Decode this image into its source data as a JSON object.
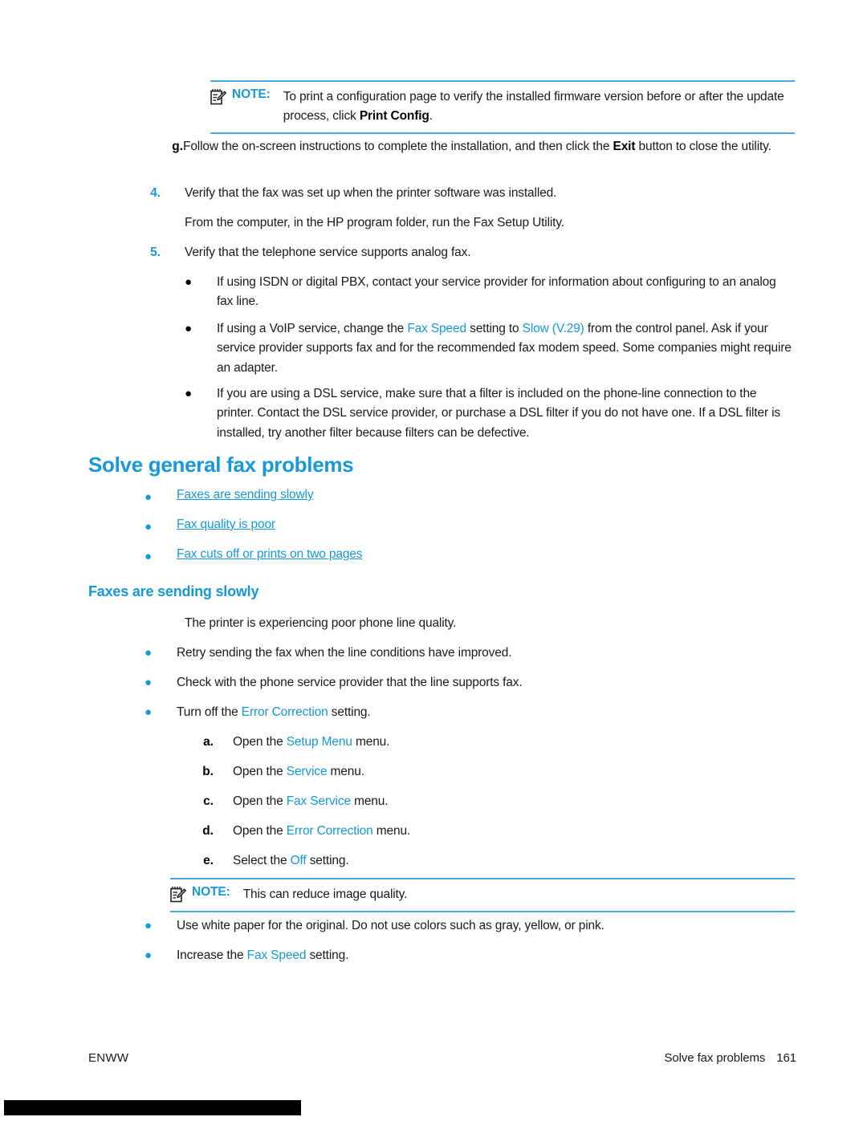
{
  "document": {
    "product": "HP printer user guide",
    "accent_color": "#1699d6",
    "note_rule_color": "#47a8e5"
  },
  "note_top": {
    "icon": "note-pad-pencil-icon",
    "label": "NOTE:",
    "text_parts": [
      {
        "text": "To print a configuration page to verify the installed firmware version before or after the update process, click ",
        "style": "plain"
      },
      {
        "text": "Print Config",
        "style": "bold"
      },
      {
        "text": ".",
        "style": "plain"
      }
    ],
    "plain_text": "To print a configuration page to verify the installed firmware version before or after the update process, click Print Config."
  },
  "step_g": {
    "marker": "g.",
    "parts": [
      {
        "text": "Follow the on-screen instructions to complete the installation, and then click the ",
        "style": "plain"
      },
      {
        "text": "Exit",
        "style": "bold"
      },
      {
        "text": " button to close the utility.",
        "style": "plain"
      }
    ]
  },
  "step_4": {
    "marker": "4.",
    "text": "Verify that the fax was set up when the printer software was installed."
  },
  "para_4": {
    "text": "From the computer, in the HP program folder, run the Fax Setup Utility."
  },
  "step_5": {
    "marker": "5.",
    "text": "Verify that the telephone service supports analog fax."
  },
  "step_5_bullets": [
    {
      "bullet": "●",
      "bullet_color": "black",
      "parts": [
        {
          "text": "If using ISDN or digital PBX, contact your service provider for information about configuring to an analog fax line.",
          "style": "plain"
        }
      ]
    },
    {
      "bullet": "●",
      "bullet_color": "black",
      "parts": [
        {
          "text": "If using a VoIP service, change the ",
          "style": "plain"
        },
        {
          "text": "Fax Speed",
          "style": "blue"
        },
        {
          "text": " setting to ",
          "style": "plain"
        },
        {
          "text": "Slow (V.29)",
          "style": "blue"
        },
        {
          "text": " from the control panel. Ask if your service provider supports fax and for the recommended fax modem speed. Some companies might require an adapter.",
          "style": "plain"
        }
      ]
    },
    {
      "bullet": "●",
      "bullet_color": "black",
      "parts": [
        {
          "text": "If you are using a DSL service, make sure that a filter is included on the phone-line connection to the printer. Contact the DSL service provider, or purchase a DSL filter if you do not have one. If a DSL filter is installed, try another filter because filters can be defective.",
          "style": "plain"
        }
      ]
    }
  ],
  "heading_1": {
    "text": "Solve general fax problems"
  },
  "toc_links": [
    {
      "bullet": "●",
      "label": "Faxes are sending slowly"
    },
    {
      "bullet": "●",
      "label": "Fax quality is poor"
    },
    {
      "bullet": "●",
      "label": "Fax cuts off or prints on two pages"
    }
  ],
  "heading_2": {
    "text": "Faxes are sending slowly"
  },
  "intro_para": {
    "text": "The printer is experiencing poor phone line quality."
  },
  "slow_bullets": [
    {
      "bullet": "●",
      "bullet_color": "blue",
      "parts": [
        {
          "text": "Retry sending the fax when the line conditions have improved.",
          "style": "plain"
        }
      ]
    },
    {
      "bullet": "●",
      "bullet_color": "blue",
      "parts": [
        {
          "text": "Check with the phone service provider that the line supports fax.",
          "style": "plain"
        }
      ]
    },
    {
      "bullet": "●",
      "bullet_color": "blue",
      "parts": [
        {
          "text": "Turn off the ",
          "style": "plain"
        },
        {
          "text": "Error Correction",
          "style": "blue"
        },
        {
          "text": " setting.",
          "style": "plain"
        }
      ]
    }
  ],
  "sub_steps": [
    {
      "marker": "a.",
      "parts": [
        {
          "text": "Open the ",
          "style": "plain"
        },
        {
          "text": "Setup Menu",
          "style": "blue"
        },
        {
          "text": " menu.",
          "style": "plain"
        }
      ]
    },
    {
      "marker": "b.",
      "parts": [
        {
          "text": "Open the ",
          "style": "plain"
        },
        {
          "text": "Service",
          "style": "blue"
        },
        {
          "text": " menu.",
          "style": "plain"
        }
      ]
    },
    {
      "marker": "c.",
      "parts": [
        {
          "text": "Open the ",
          "style": "plain"
        },
        {
          "text": "Fax Service",
          "style": "blue"
        },
        {
          "text": " menu.",
          "style": "plain"
        }
      ]
    },
    {
      "marker": "d.",
      "parts": [
        {
          "text": "Open the ",
          "style": "plain"
        },
        {
          "text": "Error Correction",
          "style": "blue"
        },
        {
          "text": " menu.",
          "style": "plain"
        }
      ]
    },
    {
      "marker": "e.",
      "parts": [
        {
          "text": "Select the ",
          "style": "plain"
        },
        {
          "text": "Off",
          "style": "blue"
        },
        {
          "text": " setting.",
          "style": "plain"
        }
      ]
    }
  ],
  "note_bottom": {
    "icon": "note-pad-pencil-icon",
    "label": "NOTE:",
    "text_parts": [
      {
        "text": "This can reduce image quality.",
        "style": "plain"
      }
    ],
    "plain_text": "This can reduce image quality."
  },
  "tail_bullets": [
    {
      "bullet": "●",
      "bullet_color": "blue",
      "parts": [
        {
          "text": "Use white paper for the original. Do not use colors such as gray, yellow, or pink.",
          "style": "plain"
        }
      ]
    },
    {
      "bullet": "●",
      "bullet_color": "blue",
      "parts": [
        {
          "text": "Increase the ",
          "style": "plain"
        },
        {
          "text": "Fax Speed",
          "style": "blue"
        },
        {
          "text": " setting.",
          "style": "plain"
        }
      ]
    }
  ],
  "footer": {
    "left": "ENWW",
    "section": "Solve fax problems",
    "page_number": "161"
  }
}
